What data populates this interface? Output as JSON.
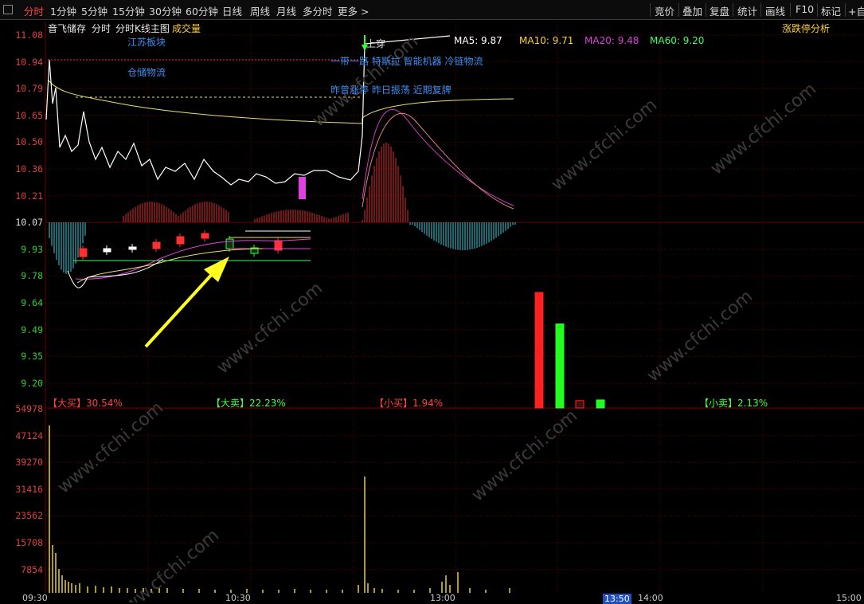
{
  "toolbar": {
    "tabs": [
      {
        "label": "分时",
        "active": true
      },
      {
        "label": "1分钟"
      },
      {
        "label": "5分钟"
      },
      {
        "label": "15分钟"
      },
      {
        "label": "30分钟"
      },
      {
        "label": "60分钟"
      },
      {
        "label": "日线"
      },
      {
        "label": "周线"
      },
      {
        "label": "月线"
      },
      {
        "label": "多分时"
      },
      {
        "label": "更多 >"
      }
    ],
    "right": [
      "竞价",
      "叠加",
      "复盘",
      "统计",
      "画线",
      "F10",
      "标记",
      "+自选"
    ]
  },
  "subheader": {
    "stock_name": "音飞储存",
    "mode1": "分时",
    "mode2": "分时K线主图",
    "mode3": "成交量",
    "analysis": "涨跌停分析"
  },
  "price_axis": [
    "11.08",
    "10.94",
    "10.79",
    "10.65",
    "10.50",
    "10.36",
    "10.21",
    "10.07",
    "9.93",
    "9.78",
    "9.64",
    "9.49",
    "9.35",
    "9.20"
  ],
  "volume_axis": [
    "54978",
    "47124",
    "39270",
    "31416",
    "23562",
    "15708",
    "7854"
  ],
  "tags": {
    "sector1": "江苏板块",
    "sector2": "仓储物流",
    "concepts": "一带一路 特斯拉 智能机器 冷链物流",
    "status": "昨曾涨停 昨日振荡 近期复牌",
    "signal": "上穿"
  },
  "ma": {
    "ma5": "MA5: 9.87",
    "ma10": "MA10: 9.71",
    "ma20": "MA20: 9.48",
    "ma60": "MA60: 9.20"
  },
  "flow": {
    "big_buy": "【大买】30.54%",
    "big_sell": "【大卖】22.23%",
    "small_buy": "【小买】1.94%",
    "small_sell": "【小卖】2.13%",
    "bars": [
      30.54,
      22.23,
      1.94,
      2.13
    ]
  },
  "time_axis": [
    "09:30",
    "10:30",
    "13:00",
    "13:50",
    "14:00",
    "15:00"
  ],
  "watermark": "www.cfchi.com",
  "colors": {
    "up": "#ff3030",
    "down": "#30ff30",
    "price": "#ffffff",
    "avg": "#ffff60",
    "ma10": "#ffd030",
    "ma20": "#e040e0",
    "ma60": "#40ff60"
  }
}
